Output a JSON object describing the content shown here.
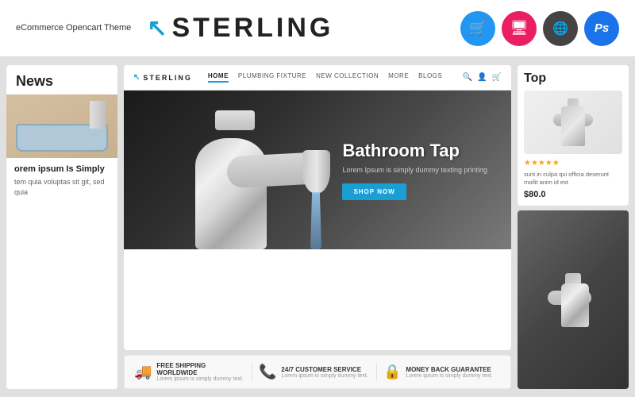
{
  "header": {
    "ecommerce_label": "eCommerce\nOpencart Theme",
    "logo_icon": "↖",
    "logo_text": "STERLING",
    "badges": [
      {
        "id": "cart",
        "icon": "🛒",
        "color": "#2196f3",
        "label": "cart-badge"
      },
      {
        "id": "responsive",
        "icon": "🖥",
        "color": "#e91e63",
        "label": "responsive-badge"
      },
      {
        "id": "multilang",
        "icon": "🌐",
        "color": "#555",
        "label": "multilang-badge"
      },
      {
        "id": "ps",
        "text": "Ps",
        "color": "#1a73e8",
        "label": "photoshop-badge"
      }
    ]
  },
  "left_panel": {
    "news_header": "News",
    "news_title": "orem ipsum Is Simply",
    "news_desc": "tem quia voluptas sit\ngit, sed quia"
  },
  "browser": {
    "logo_icon": "↖",
    "logo_text": "STERLING",
    "nav_links": [
      {
        "label": "HOME",
        "active": true
      },
      {
        "label": "PLUMBING FIXTURE",
        "active": false
      },
      {
        "label": "NEW COLLECTION",
        "active": false
      },
      {
        "label": "MORE",
        "active": false
      },
      {
        "label": "BLOGS",
        "active": false
      }
    ],
    "icons": [
      "🔍",
      "👤",
      "🛒"
    ]
  },
  "hero": {
    "title": "Bathroom Tap",
    "subtitle": "Lorem Ipsum is simply dummy texting printing",
    "cta_label": "SHOP NOW"
  },
  "features": [
    {
      "icon": "🚚",
      "title": "FREE SHIPPING WORLDWIDE",
      "desc": "Lorem ipsum is simply dummy text."
    },
    {
      "icon": "📞",
      "title": "24/7 CUSTOMER SERVICE",
      "desc": "Lorem ipsum is simply dummy text."
    },
    {
      "icon": "🔒",
      "title": "MONEY BACK GUARANTEE",
      "desc": "Lorem ipsum is simply dummy text."
    }
  ],
  "right_panel": {
    "top_label": "Top",
    "product": {
      "stars": "★★★★★",
      "description": "sunt in culpa qui officia deserunt mollit anim id est",
      "price": "$80.0"
    }
  }
}
